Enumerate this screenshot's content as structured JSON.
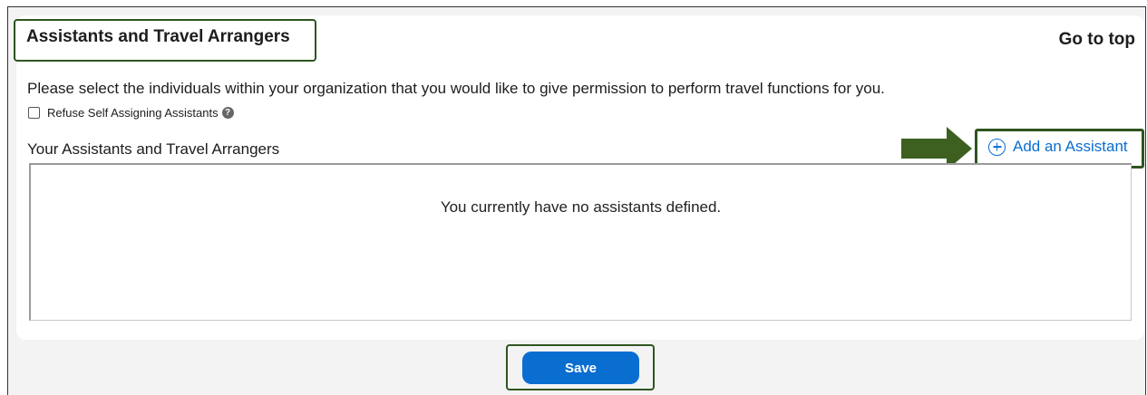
{
  "section": {
    "title": "Assistants and Travel Arrangers",
    "go_to_top": "Go to top",
    "description": "Please select the individuals within your organization that you would like to give permission to perform travel functions for you."
  },
  "refuse_checkbox": {
    "label": "Refuse Self Assigning Assistants",
    "checked": false,
    "help_icon": "question-circle-icon",
    "help_glyph": "?"
  },
  "assistants": {
    "heading": "Your Assistants and Travel Arrangers",
    "add_label": "Add an Assistant",
    "add_icon": "plus-circle-icon",
    "empty_message": "You currently have no assistants defined.",
    "items": []
  },
  "actions": {
    "save_label": "Save"
  },
  "colors": {
    "accent": "#0a6ed1",
    "highlight_border": "#2f5520",
    "arrow": "#3d6021",
    "page_bg": "#f3f3f4"
  }
}
